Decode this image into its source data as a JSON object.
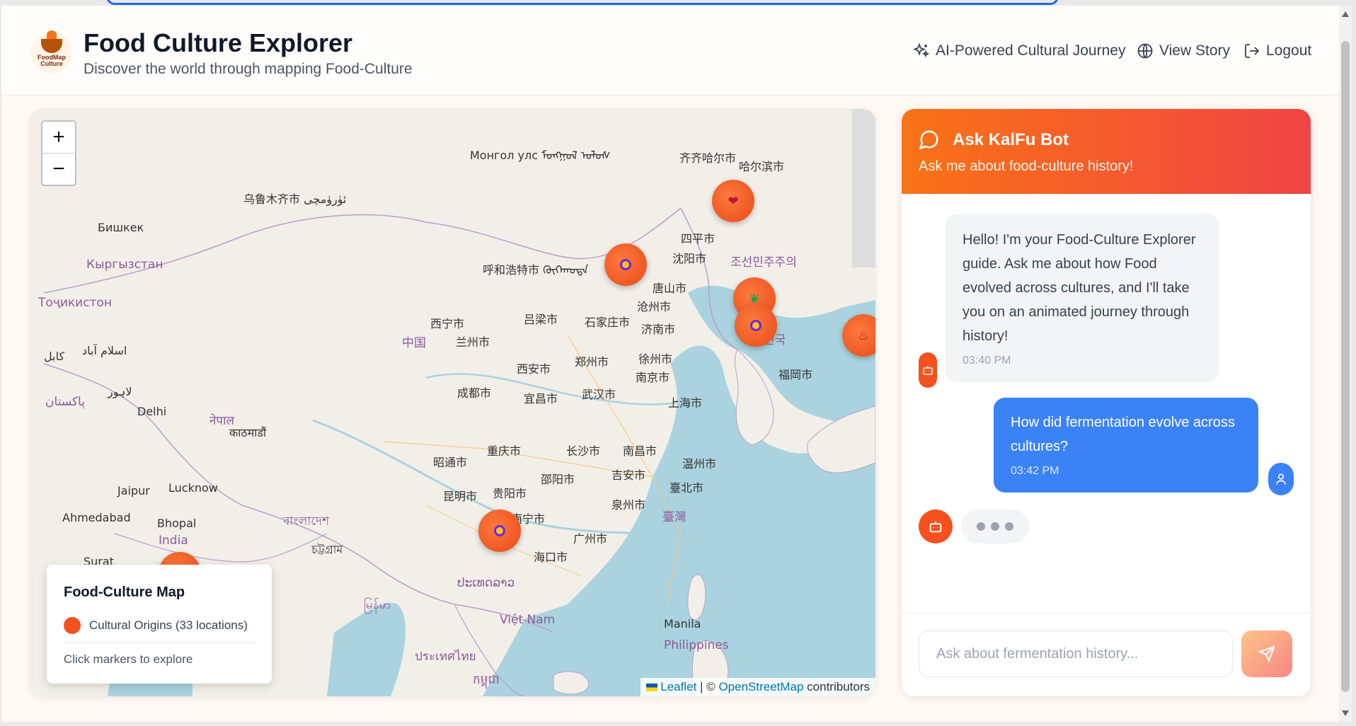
{
  "header": {
    "logo_text": "FoodMap Culture",
    "title": "Food Culture Explorer",
    "subtitle": "Discover the world through mapping Food-Culture",
    "nav": {
      "journey": "AI-Powered Cultural Journey",
      "story": "View Story",
      "logout": "Logout"
    }
  },
  "map": {
    "zoom_in": "+",
    "zoom_out": "−",
    "labels": {
      "mongolia": "Монгол улс ᠮᠣᠩᠭᠣᠯ ᠤᠯᠤᠰ",
      "urumqi": "乌鲁木齐市 ئۈرۈمچی",
      "bishkek": "Бишкек",
      "kyrgyzstan": "Кыргызстан",
      "tajikistan": "Тоҷикистон",
      "hohhot": "呼和浩特市 ᠬᠦᠬᠡᠬᠣᠲᠠ",
      "qiqihar": "齐齐哈尔市",
      "harbin": "哈尔滨市",
      "siping": "四平市",
      "shenyang": "沈阳市",
      "tangshan": "唐山市",
      "cangzhou": "沧州市",
      "northkorea": "조선민주주의",
      "xining": "西宁市",
      "lvliang": "吕梁市",
      "shijiazhuang": "石家庄市",
      "jinan": "济南市",
      "china": "中国",
      "lanzhou": "兰州市",
      "xian": "西安市",
      "zhengzhou": "郑州市",
      "xuzhou": "徐州市",
      "nanjing": "南京市",
      "southkorea": "대한민국",
      "fukuoka": "福岡市",
      "kabul": "کابل",
      "islamabad": "اسلام آباد",
      "pakistan": "پاکستان",
      "lahore": "لاہور",
      "delhi": "Delhi",
      "nepal": "नेपाल",
      "kathmandu": "काठमाडौं",
      "chengdu": "成都市",
      "yichang": "宜昌市",
      "wuhan": "武汉市",
      "shanghai": "上海市",
      "chongqing": "重庆市",
      "changsha": "长沙市",
      "nanchang": "南昌市",
      "wenzhou": "温州市",
      "zhaotong": "昭通市",
      "kunming": "昆明市",
      "guiyang": "贵阳市",
      "shaoyang": "邵阳市",
      "jian": "吉安市",
      "taipei": "臺北市",
      "jaipur": "Jaipur",
      "lucknow": "Lucknow",
      "quanzhou": "泉州市",
      "taiwan": "臺灣",
      "ahmedabad": "Ahmedabad",
      "bhopal": "Bhopal",
      "india": "India",
      "bangladesh": "বাংলাদেশ",
      "nanning": "南宁市",
      "guangzhou": "广州市",
      "haikou": "海口市",
      "chattogram": "চট্টগ্রাম",
      "surat": "Surat",
      "myanmar": "မြန်မာ",
      "laos": "ປະເທດລາວ",
      "vietnam": "Việt Nam",
      "manila": "Manila",
      "philippines": "Philippines",
      "thailand": "ประเทศไทย",
      "cambodia": "កម្ពុជា"
    },
    "legend": {
      "title": "Food-Culture Map",
      "item": "Cultural Origins (33 locations)",
      "hint": "Click markers to explore"
    },
    "attribution": {
      "leaflet": "Leaflet",
      "sep": " | © ",
      "osm": "OpenStreetMap",
      "contrib": " contributors"
    }
  },
  "chat": {
    "title": "Ask KalFu Bot",
    "subtitle": "Ask me about food-culture history!",
    "messages": [
      {
        "text": "Hello! I'm your Food-Culture Explorer guide. Ask me about how Food evolved across cultures, and I'll take you on an animated journey through history!",
        "time": "03:40 PM"
      },
      {
        "text": "How did fermentation evolve across cultures?",
        "time": "03:42 PM"
      }
    ],
    "input_placeholder": "Ask about fermentation history..."
  }
}
